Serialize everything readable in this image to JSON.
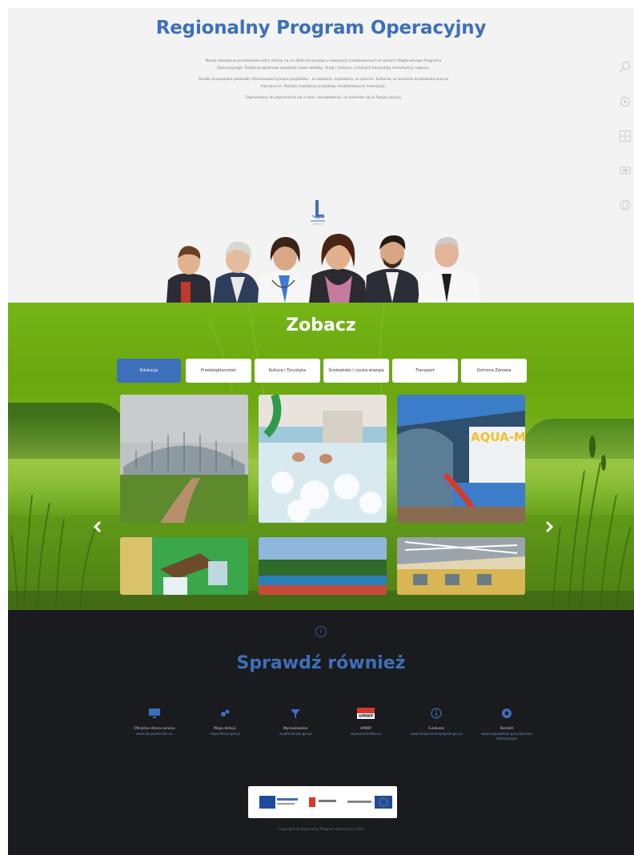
{
  "top": {
    "title": "Regionalny Program Operacyjny",
    "intro_paragraphs": [
      "Nasza kampania przedstawia ludzi, którzy na co dzień korzystają z inwestycji zrealizowanych w ramach Regionalnego Programu Operacyjnego. Dzięki programowi powstały nowe obiekty, drogi i miejsca, z których korzystają mieszkańcy regionu.",
      "Środki europejskie pozwoliły sfinansować tysiące projektów – w szkołach, szpitalach, w sporcie i kulturze, w ochronie środowiska oraz w transporcie. Poniżej znajdziesz przykłady zrealizowanych inwestycji.",
      "Zapraszamy do zapoznania się z nimi i sprawdzenia, co zmieniło się w Twojej okolicy."
    ],
    "side_icons": [
      "search-icon",
      "gear-icon",
      "grid-icon",
      "share-icon",
      "globe-icon"
    ]
  },
  "gallery": {
    "title": "Zobacz",
    "tabs": [
      {
        "label": "Edukacja",
        "active": true
      },
      {
        "label": "Przedsiębiorczość",
        "active": false
      },
      {
        "label": "Kultura i Turystyka",
        "active": false
      },
      {
        "label": "Środowisko i czysta energia",
        "active": false
      },
      {
        "label": "Transport",
        "active": false
      },
      {
        "label": "Ochrona Zdrowia",
        "active": false
      }
    ],
    "tiles": [
      "sports-hall-dome",
      "indoor-pool",
      "aqua-park",
      "school-building",
      "sports-field",
      "gym-interior"
    ],
    "tile_sign_text": "AQUA-M",
    "prev_icon": "chevron-left-icon",
    "next_icon": "chevron-right-icon",
    "colors": {
      "active_tab": "#3d6fbb",
      "background": "#75b516"
    }
  },
  "more": {
    "title": "Sprawdź również",
    "links": [
      {
        "icon": "monitor-icon",
        "title": "Oficjalna strona serwisu",
        "sub": "www.rpo.pomorskie.eu"
      },
      {
        "icon": "pin-icon",
        "title": "Mapa dotacji",
        "sub": "mapadotacji.gov.pl"
      },
      {
        "icon": "funnel-icon",
        "title": "Wyszukiwarka",
        "sub": "mojefundusze.gov.pl"
      },
      {
        "icon": "umwp-logo",
        "title": "UMWP",
        "sub": "www.pomorskie.eu",
        "badge": "UMWP"
      },
      {
        "icon": "info-icon",
        "title": "Fundusze",
        "sub": "www.funduszeeuropejskie.gov.pl"
      },
      {
        "icon": "help-icon",
        "title": "Kontakt",
        "sub": "www.mapadotacji.gov.pl/punkty informacyjne"
      }
    ],
    "copyright": "Copyright by Regionalny Program Operacyjny 2015",
    "accent": "#3d6fbb"
  }
}
